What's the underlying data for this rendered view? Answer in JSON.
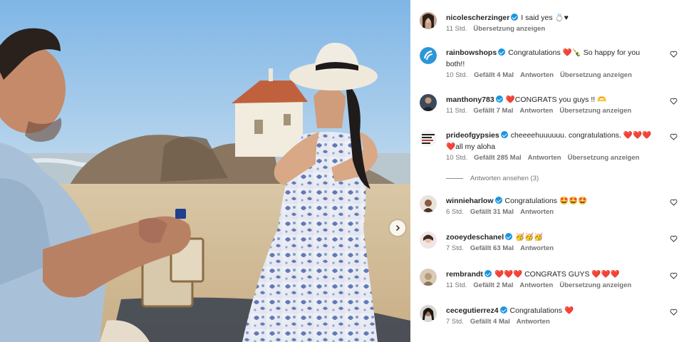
{
  "colors": {
    "verified": "#1b95e0",
    "meta_text": "#737373",
    "text": "#262626",
    "heart": "#e0245e"
  },
  "photo": {
    "next_icon": "chevron-right-icon"
  },
  "comments": [
    {
      "username": "nicolescherzinger",
      "text": "I said yes 💍♥",
      "time": "11 Std.",
      "likes": "",
      "reply": "",
      "translate": "Übersetzung anzeigen",
      "is_caption": true
    },
    {
      "username": "rainbowshops",
      "text": "Congratulations ❤️🍾 So happy for you both!!",
      "time": "10 Std.",
      "likes": "Gefällt 4 Mal",
      "reply": "Antworten",
      "translate": "Übersetzung anzeigen"
    },
    {
      "username": "manthony783",
      "text": "❤️CONGRATS you guys !! 🫶",
      "time": "11 Std.",
      "likes": "Gefällt 7 Mal",
      "reply": "Antworten",
      "translate": "Übersetzung anzeigen"
    },
    {
      "username": "prideofgypsies",
      "text": "cheeeehuuuuuu. congratulations. ❤️❤️❤️ ❤️all my aloha",
      "time": "10 Std.",
      "likes": "Gefällt 285 Mal",
      "reply": "Antworten",
      "translate": "Übersetzung anzeigen"
    },
    {
      "username": "winnieharlow",
      "text": "Congratulations 🤩🤩🤩",
      "time": "6 Std.",
      "likes": "Gefällt 31 Mal",
      "reply": "Antworten",
      "translate": ""
    },
    {
      "username": "zooeydeschanel",
      "text": "🥳🥳🥳",
      "time": "7 Std.",
      "likes": "Gefällt 63 Mal",
      "reply": "Antworten",
      "translate": ""
    },
    {
      "username": "rembrandt",
      "text": "❤️❤️❤️ CONGRATS GUYS ❤️❤️❤️",
      "time": "11 Std.",
      "likes": "Gefällt 2 Mal",
      "reply": "Antworten",
      "translate": "Übersetzung anzeigen"
    },
    {
      "username": "cecegutierrez4",
      "text": "Congratulations ❤️",
      "time": "7 Std.",
      "likes": "Gefällt 4 Mal",
      "reply": "Antworten",
      "translate": ""
    }
  ],
  "view_replies": "Antworten ansehen (3)"
}
